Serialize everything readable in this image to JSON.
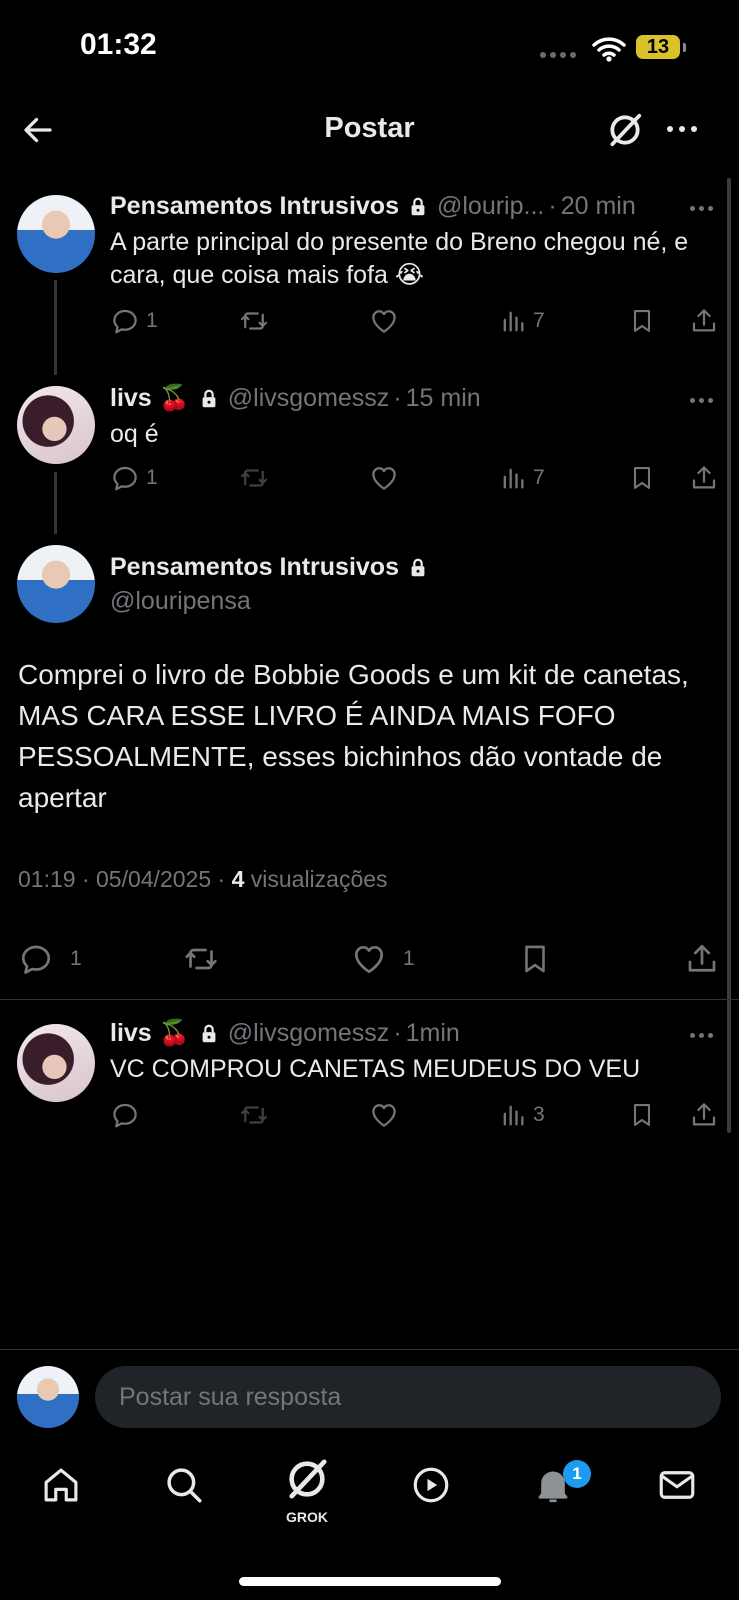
{
  "status_bar": {
    "time": "01:32",
    "battery": "13"
  },
  "header": {
    "title": "Postar"
  },
  "thread": [
    {
      "name": "Pensamentos Intrusivos",
      "handle": "@lourip...",
      "time": "20 min",
      "text": "A parte principal do presente do Breno chegou né, e cara, que coisa mais fofa 😭",
      "actions": {
        "replies": "1",
        "retweets": "",
        "likes": "",
        "views": "7"
      }
    },
    {
      "name": "livs 🍒",
      "handle": "@livsgomessz",
      "time": "15 min",
      "text": "oq é",
      "actions": {
        "replies": "1",
        "retweets": "",
        "likes": "",
        "views": "7"
      }
    }
  ],
  "main_post": {
    "name": "Pensamentos Intrusivos",
    "handle": "@louripensa",
    "text": "Comprei o livro de Bobbie Goods e um kit de canetas, MAS CARA ESSE LIVRO É AINDA MAIS FOFO PESSOALMENTE, esses bichinhos dão vontade de apertar",
    "timestamp": "01:19 · 05/04/2025 · ",
    "views_count": "4",
    "views_label": "visualizações",
    "actions": {
      "replies": "1",
      "likes": "1"
    }
  },
  "reply": {
    "name": "livs 🍒",
    "handle": "@livsgomessz",
    "time": "1min",
    "text": "VC COMPROU CANETAS MEUDEUS DO VEU",
    "actions": {
      "replies": "",
      "retweets": "",
      "likes": "",
      "views": "3"
    }
  },
  "composer": {
    "placeholder": "Postar sua resposta"
  },
  "bottom_nav": {
    "grok_label": "GROK",
    "notifications_badge": "1"
  },
  "icons": {
    "back": "arrow-left-icon",
    "grok": "grok-icon",
    "more": "more-icon",
    "reply": "reply-icon",
    "retweet": "retweet-icon",
    "like": "heart-icon",
    "views": "views-icon",
    "bookmark": "bookmark-icon",
    "share": "share-icon",
    "home": "home-icon",
    "search": "search-icon",
    "video": "play-icon",
    "notifications": "bell-icon",
    "messages": "mail-icon",
    "lock": "lock-icon"
  },
  "colors": {
    "background": "#000000",
    "text": "#e7e9ea",
    "muted": "#71767b",
    "accent": "#1d9bf0",
    "battery": "#d9c12a"
  }
}
